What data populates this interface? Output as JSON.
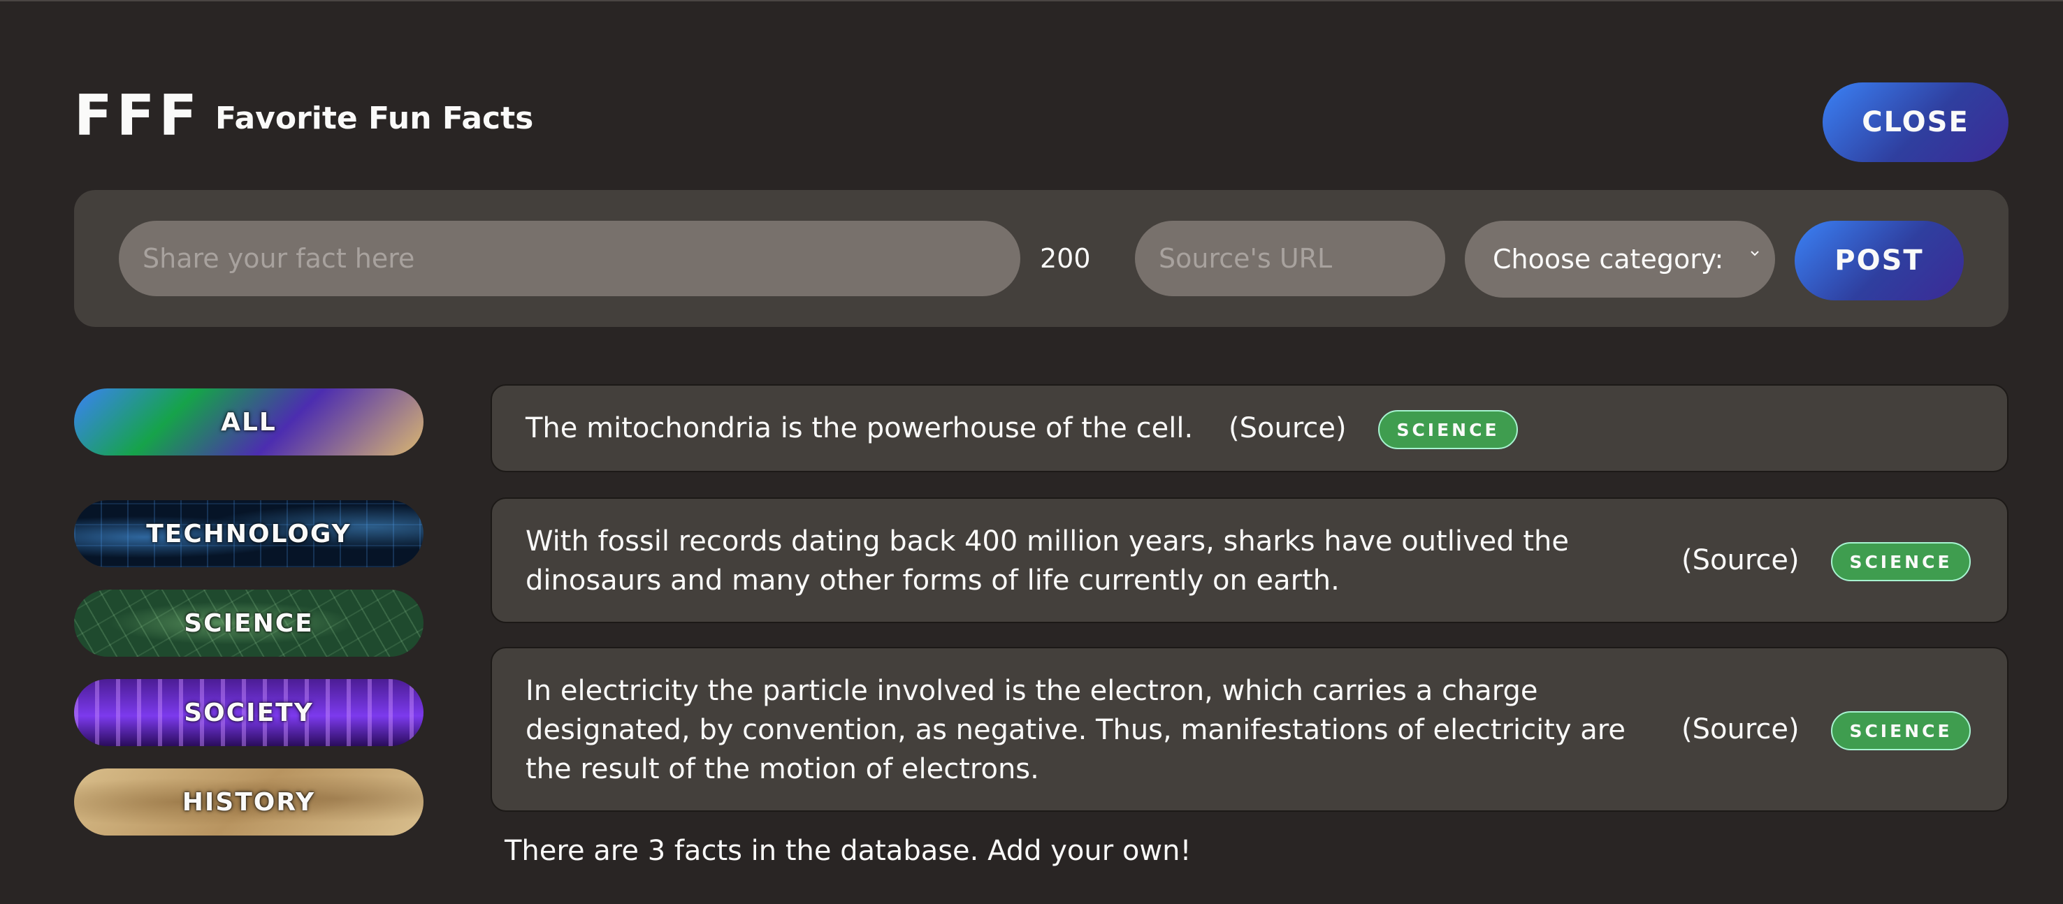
{
  "header": {
    "logo": "FFF",
    "subtitle": "Favorite Fun Facts",
    "close_label": "CLOSE"
  },
  "form": {
    "fact_placeholder": "Share your fact here",
    "char_count": "200",
    "url_placeholder": "Source's URL",
    "category_select": "Choose category:",
    "post_label": "POST"
  },
  "categories": [
    {
      "label": "ALL"
    },
    {
      "label": "TECHNOLOGY"
    },
    {
      "label": "SCIENCE"
    },
    {
      "label": "SOCIETY"
    },
    {
      "label": "HISTORY"
    }
  ],
  "facts": [
    {
      "lines": [
        "The mitochondria is the powerhouse of the cell."
      ],
      "source": "(Source)",
      "category": "SCIENCE",
      "category_color": "#3f9d4f"
    },
    {
      "lines": [
        "With fossil records dating back 400 million years, sharks have outlived the",
        "dinosaurs and many other forms of life currently on earth."
      ],
      "source": "(Source)",
      "category": "SCIENCE",
      "category_color": "#3f9d4f"
    },
    {
      "lines": [
        "In electricity the particle involved is the electron, which carries a charge",
        "designated, by convention, as negative. Thus, manifestations of electricity are",
        "the result of the motion of electrons."
      ],
      "source": "(Source)",
      "category": "SCIENCE",
      "category_color": "#3f9d4f"
    }
  ],
  "footer": {
    "message": "There are 3 facts in the database. Add your own!"
  },
  "colors": {
    "background": "#292524",
    "panel": "#44403c",
    "input": "#78716c",
    "science": "#3f9d4f"
  }
}
